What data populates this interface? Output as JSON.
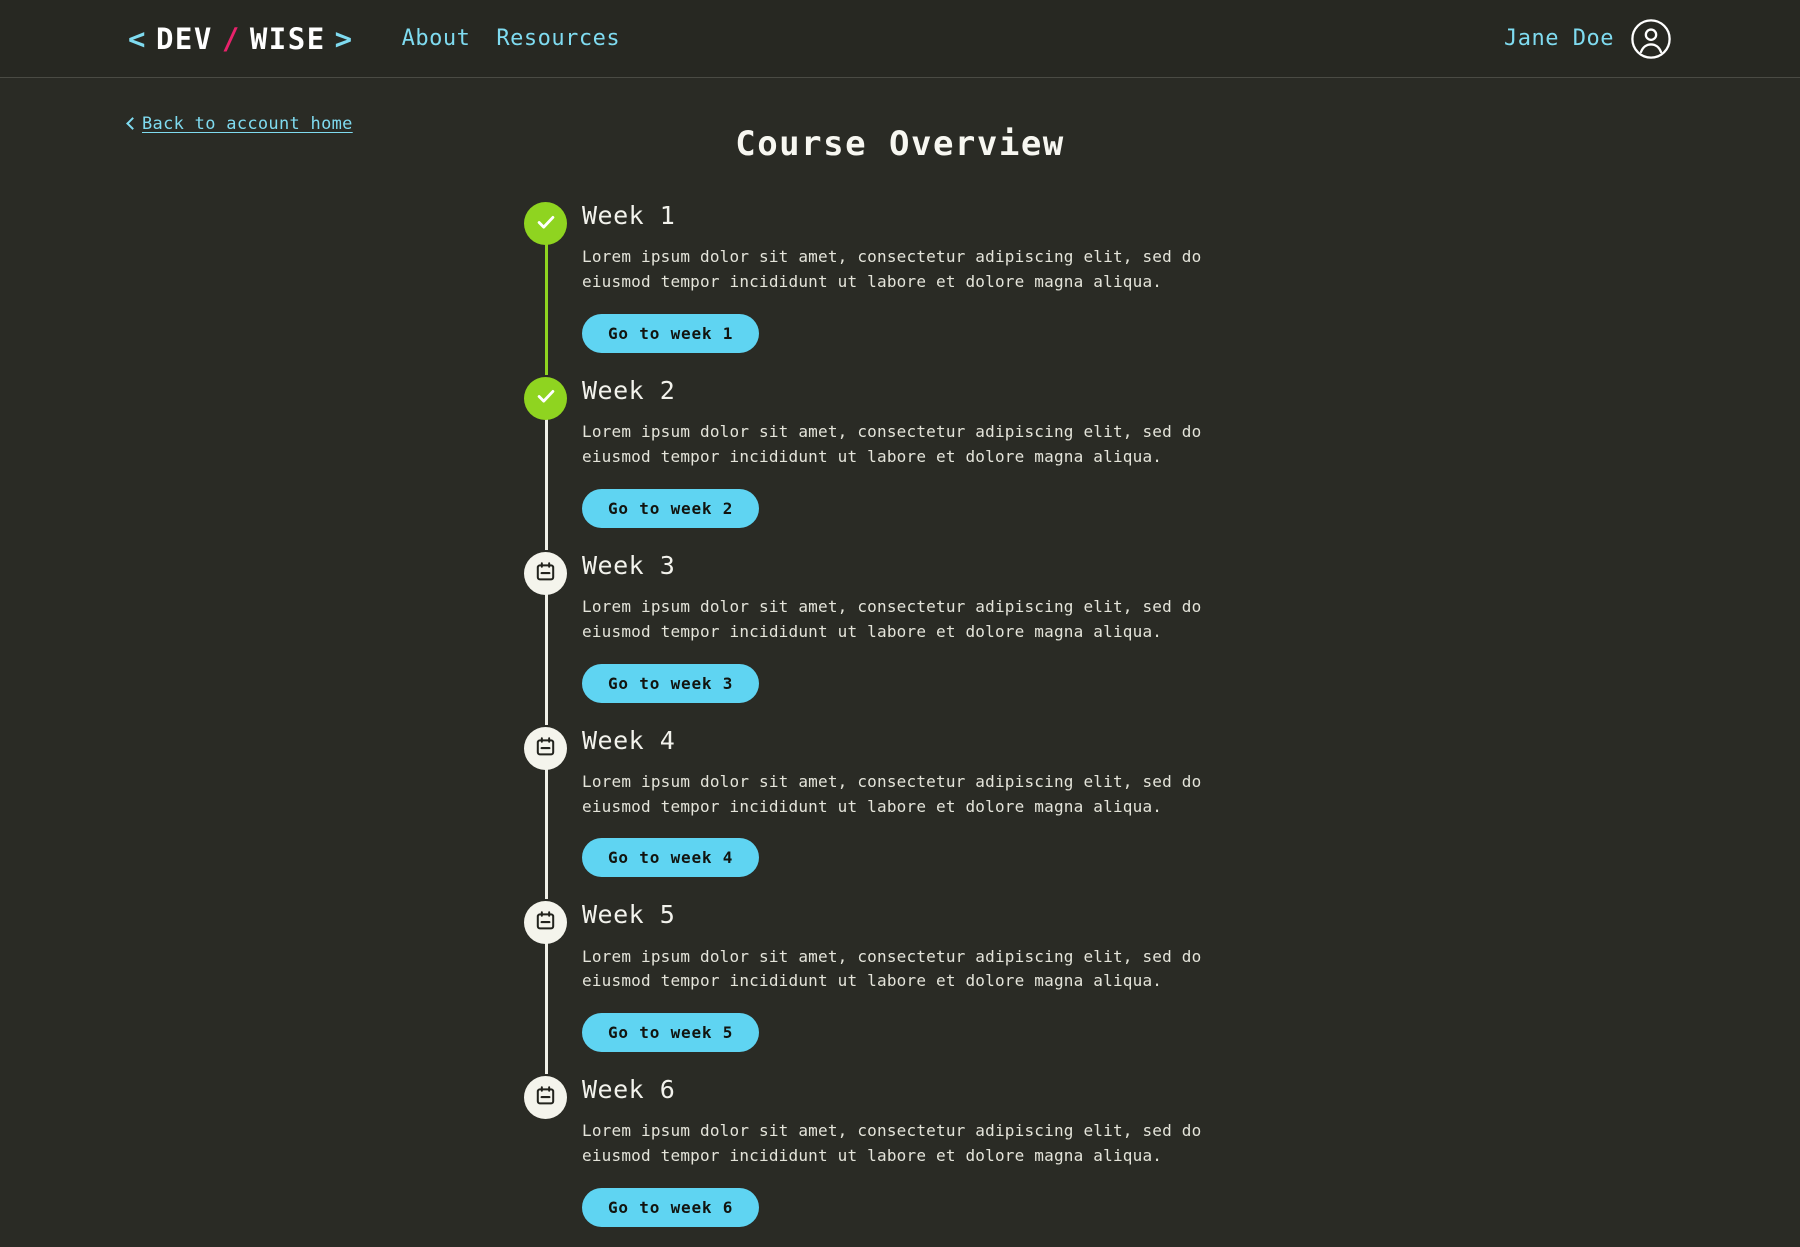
{
  "header": {
    "logo": {
      "open_bracket": "<",
      "word1": "DEV",
      "slash": "/",
      "word2": "WISE",
      "close_bracket": ">"
    },
    "nav": [
      {
        "label": "About"
      },
      {
        "label": "Resources"
      }
    ],
    "user": {
      "name": "Jane Doe",
      "avatar_icon": "user-circle-icon"
    }
  },
  "page": {
    "back_link": {
      "label": "Back to account home",
      "chevron_icon": "chevron-left-icon"
    },
    "title": "Course Overview"
  },
  "timeline": {
    "items": [
      {
        "title": "Week 1",
        "description": "Lorem ipsum dolor sit amet, consectetur adipiscing elit, sed do eiusmod tempor incididunt ut labore et dolore magna aliqua.",
        "button_label": "Go to week 1",
        "status": "completed",
        "marker_icon": "check-icon"
      },
      {
        "title": "Week 2",
        "description": "Lorem ipsum dolor sit amet, consectetur adipiscing elit, sed do eiusmod tempor incididunt ut labore et dolore magna aliqua.",
        "button_label": "Go to week 2",
        "status": "completed",
        "marker_icon": "check-icon"
      },
      {
        "title": "Week 3",
        "description": "Lorem ipsum dolor sit amet, consectetur adipiscing elit, sed do eiusmod tempor incididunt ut labore et dolore magna aliqua.",
        "button_label": "Go to week 3",
        "status": "upcoming",
        "marker_icon": "calendar-icon"
      },
      {
        "title": "Week 4",
        "description": "Lorem ipsum dolor sit amet, consectetur adipiscing elit, sed do eiusmod tempor incididunt ut labore et dolore magna aliqua.",
        "button_label": "Go to week 4",
        "status": "upcoming",
        "marker_icon": "calendar-icon"
      },
      {
        "title": "Week 5",
        "description": "Lorem ipsum dolor sit amet, consectetur adipiscing elit, sed do eiusmod tempor incididunt ut labore et dolore magna aliqua.",
        "button_label": "Go to week 5",
        "status": "upcoming",
        "marker_icon": "calendar-icon"
      },
      {
        "title": "Week 6",
        "description": "Lorem ipsum dolor sit amet, consectetur adipiscing elit, sed do eiusmod tempor incididunt ut labore et dolore magna aliqua.",
        "button_label": "Go to week 6",
        "status": "upcoming",
        "marker_icon": "calendar-icon"
      }
    ]
  },
  "colors": {
    "background": "#2a2b25",
    "header_background": "#272822",
    "accent_cyan": "#7fdbf0",
    "button_cyan": "#5fd4f2",
    "completed_green": "#8fd420",
    "logo_pink": "#e8226b",
    "text": "#f2f2ec"
  }
}
